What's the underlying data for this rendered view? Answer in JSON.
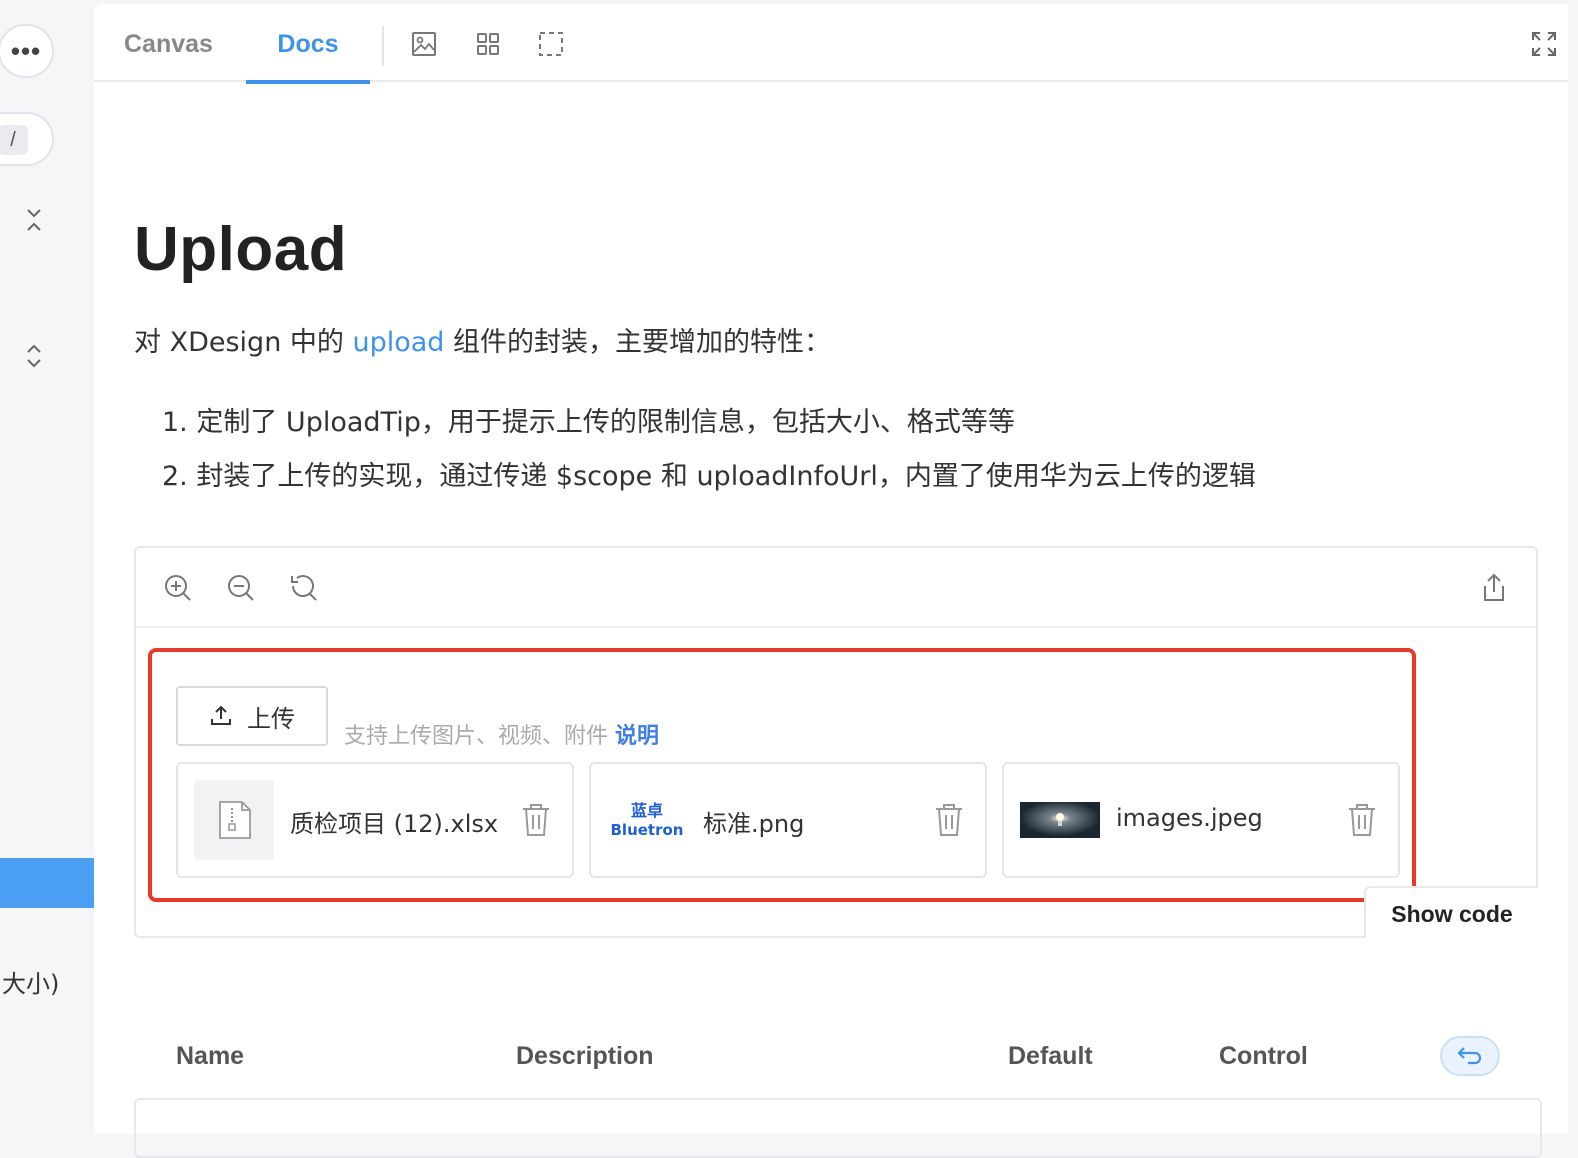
{
  "sidebar": {
    "more_label": "•••",
    "search_shortcut": "/",
    "size_text": "大小)"
  },
  "tabs": [
    {
      "label": "Canvas"
    },
    {
      "label": "Docs"
    }
  ],
  "toolbar_icons": [
    "image-icon",
    "grid-icon",
    "frame-icon"
  ],
  "doc": {
    "title": "Upload",
    "intro_before": "对 XDesign 中的 ",
    "intro_link": "upload",
    "intro_after": " 组件的封装，主要增加的特性：",
    "features": [
      "1. 定制了 UploadTip，用于提示上传的限制信息，包括大小、格式等等",
      "2. 封装了上传的实现，通过传递 $scope 和 uploadInfoUrl，内置了使用华为云上传的逻辑"
    ]
  },
  "demo": {
    "upload_button": "上传",
    "tip_text": "支持上传图片、视频、附件",
    "tip_link": "说明",
    "files": [
      {
        "name": "质检项目 (12).xlsx",
        "thumb": "file-icon"
      },
      {
        "name": "标准.png",
        "thumb": "bluetron-logo",
        "logo_cn": "蓝卓",
        "logo_en": "Bluetron"
      },
      {
        "name": "images.jpeg",
        "thumb": "lightbulb-image"
      }
    ],
    "show_code": "Show code"
  },
  "props_table": {
    "headers": [
      "Name",
      "Description",
      "Default",
      "Control"
    ]
  },
  "colors": {
    "accent": "#3f93ec",
    "highlight": "#e53a2a",
    "sidebar_active": "#4a9ff5"
  }
}
